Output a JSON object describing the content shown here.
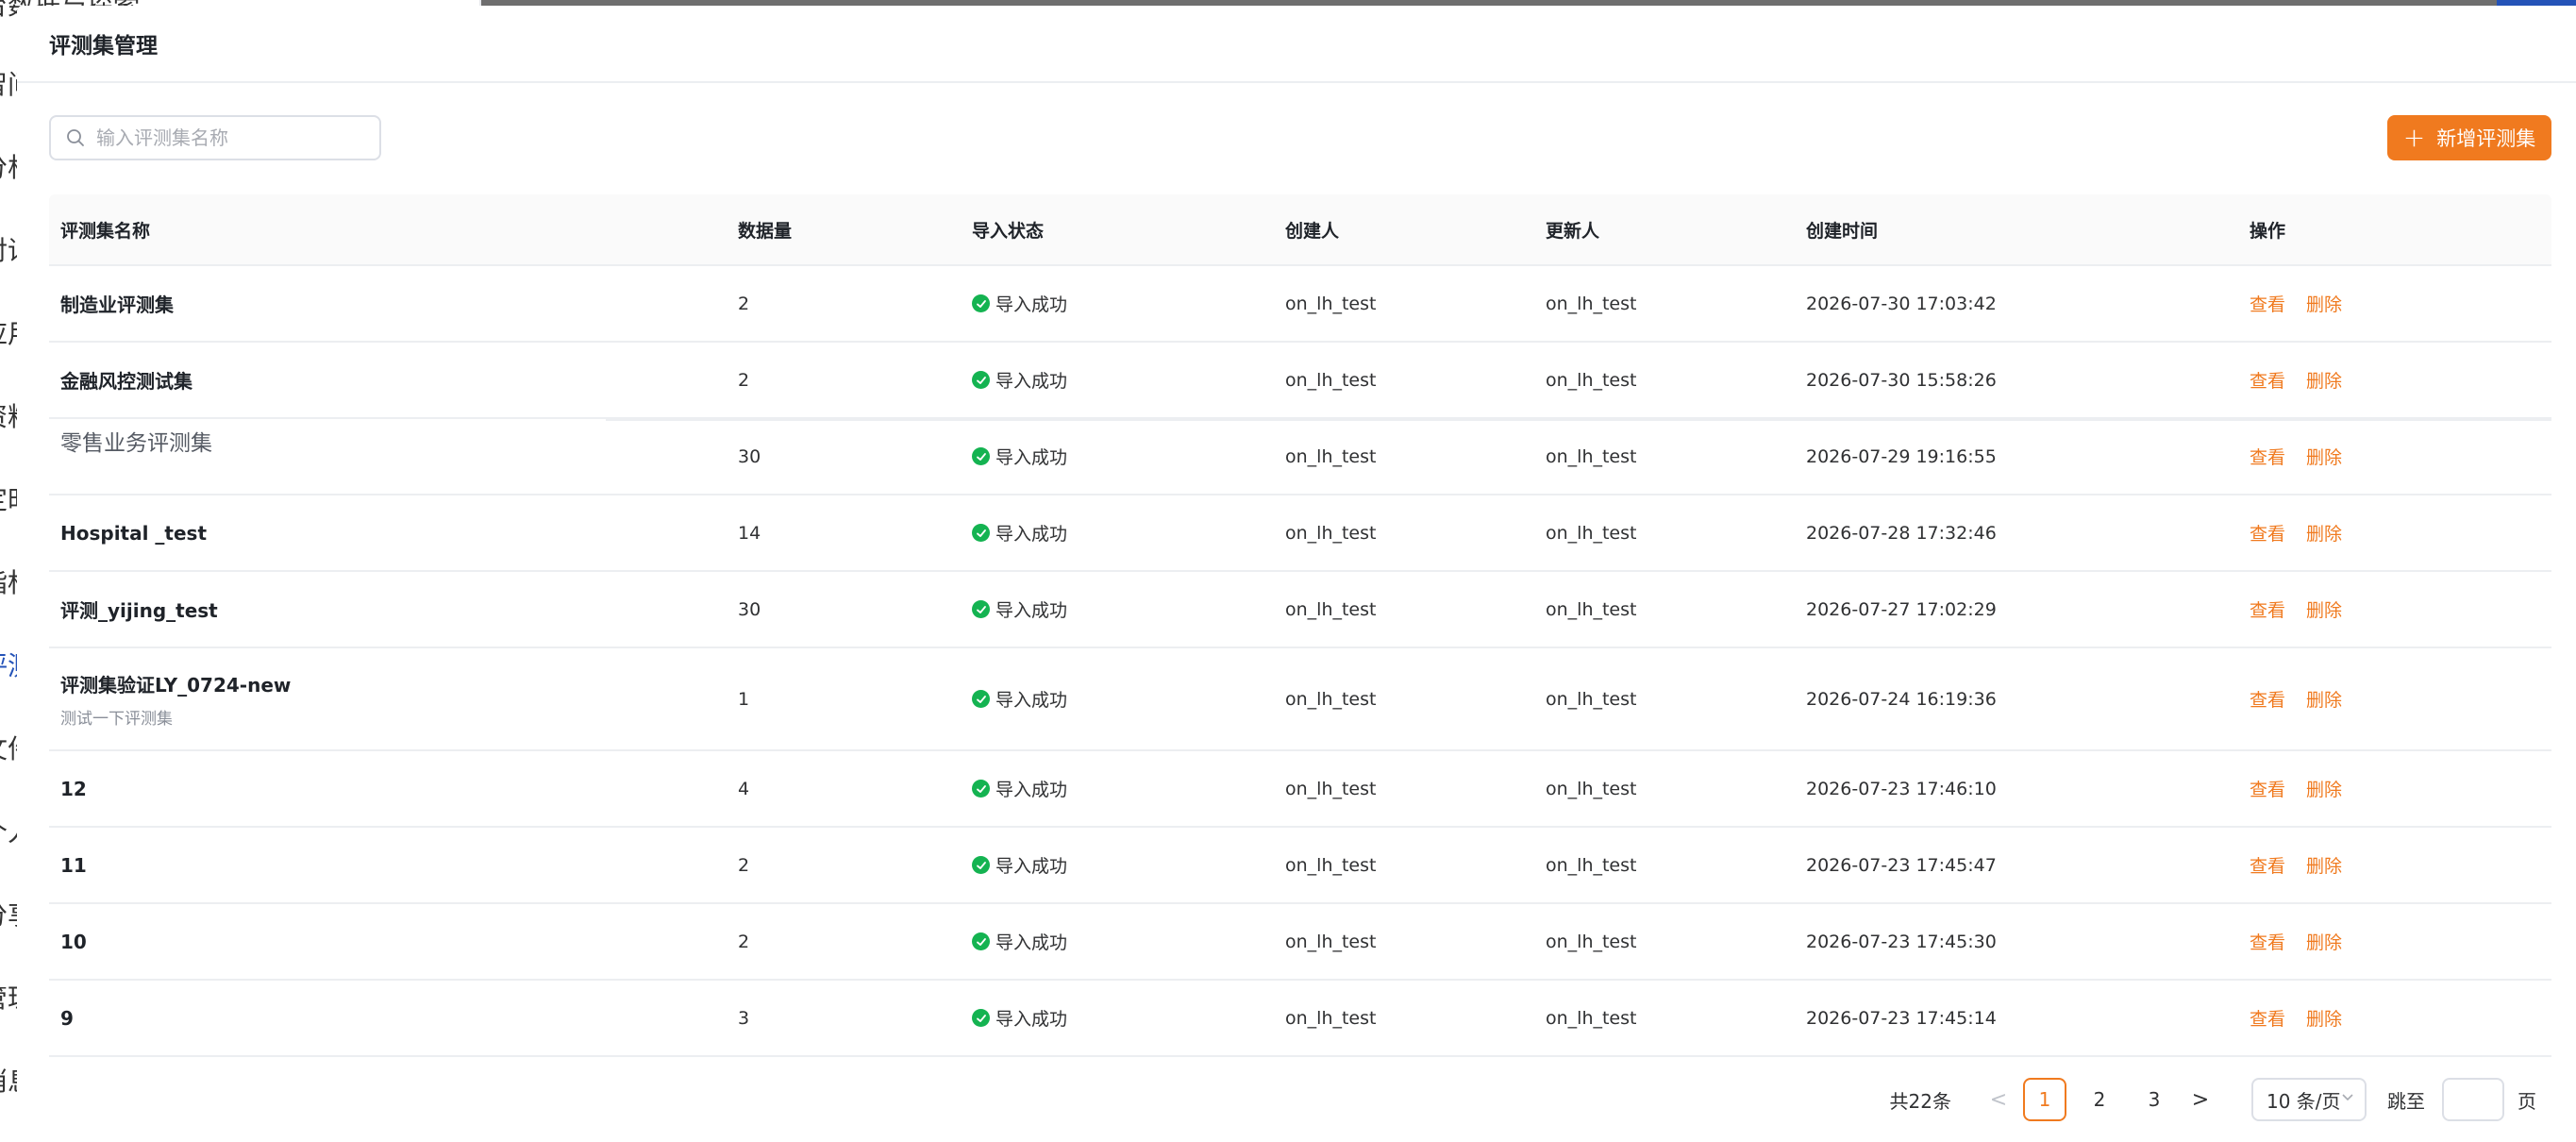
{
  "background": {
    "sidebar_fragments": [
      "台数据与探索",
      "智问",
      "分析",
      "对话",
      "应用",
      "资料",
      "定时",
      "指标",
      "评测",
      "文件",
      "个人",
      "分享",
      "管理",
      "消息"
    ]
  },
  "modal": {
    "title": "评测集管理"
  },
  "toolbar": {
    "search_placeholder": "输入评测集名称",
    "add_label": "新增评测集"
  },
  "table": {
    "headers": [
      "评测集名称",
      "数据量",
      "导入状态",
      "创建人",
      "更新人",
      "创建时间",
      "操作"
    ],
    "rows": [
      {
        "name": "制造业评测集",
        "desc": "",
        "count": "2",
        "status": "导入成功",
        "creator": "on_lh_test",
        "updater": "on_lh_test",
        "created": "2026-07-30 17:03:42",
        "view": "查看",
        "delete": "删除"
      },
      {
        "name": "金融风控测试集",
        "desc": "",
        "count": "2",
        "status": "导入成功",
        "creator": "on_lh_test",
        "updater": "on_lh_test",
        "created": "2026-07-30 15:58:26",
        "view": "查看",
        "delete": "删除"
      },
      {
        "name": "零售业务评测集",
        "desc": "",
        "count": "30",
        "status": "导入成功",
        "creator": "on_lh_test",
        "updater": "on_lh_test",
        "created": "2026-07-29 19:16:55",
        "view": "查看",
        "delete": "删除"
      },
      {
        "name": "Hospital _test",
        "desc": "",
        "count": "14",
        "status": "导入成功",
        "creator": "on_lh_test",
        "updater": "on_lh_test",
        "created": "2026-07-28 17:32:46",
        "view": "查看",
        "delete": "删除"
      },
      {
        "name": "评测_yijing_test",
        "desc": "",
        "count": "30",
        "status": "导入成功",
        "creator": "on_lh_test",
        "updater": "on_lh_test",
        "created": "2026-07-27 17:02:29",
        "view": "查看",
        "delete": "删除"
      },
      {
        "name": "评测集验证LY_0724-new",
        "desc": "测试一下评测集",
        "count": "1",
        "status": "导入成功",
        "creator": "on_lh_test",
        "updater": "on_lh_test",
        "created": "2026-07-24 16:19:36",
        "view": "查看",
        "delete": "删除"
      },
      {
        "name": "12",
        "desc": "",
        "count": "4",
        "status": "导入成功",
        "creator": "on_lh_test",
        "updater": "on_lh_test",
        "created": "2026-07-23 17:46:10",
        "view": "查看",
        "delete": "删除"
      },
      {
        "name": "11",
        "desc": "",
        "count": "2",
        "status": "导入成功",
        "creator": "on_lh_test",
        "updater": "on_lh_test",
        "created": "2026-07-23 17:45:47",
        "view": "查看",
        "delete": "删除"
      },
      {
        "name": "10",
        "desc": "",
        "count": "2",
        "status": "导入成功",
        "creator": "on_lh_test",
        "updater": "on_lh_test",
        "created": "2026-07-23 17:45:30",
        "view": "查看",
        "delete": "删除"
      },
      {
        "name": "9",
        "desc": "",
        "count": "3",
        "status": "导入成功",
        "creator": "on_lh_test",
        "updater": "on_lh_test",
        "created": "2026-07-23 17:45:14",
        "view": "查看",
        "delete": "删除"
      }
    ]
  },
  "pagination": {
    "total": "共22条",
    "prev": "<",
    "pages": [
      "1",
      "2",
      "3"
    ],
    "current": "1",
    "next": ">",
    "page_size": "10 条/页",
    "jump_label": "跳至",
    "jump_unit": "页"
  },
  "colors": {
    "accent": "#f07a1f",
    "success": "#14b351"
  }
}
